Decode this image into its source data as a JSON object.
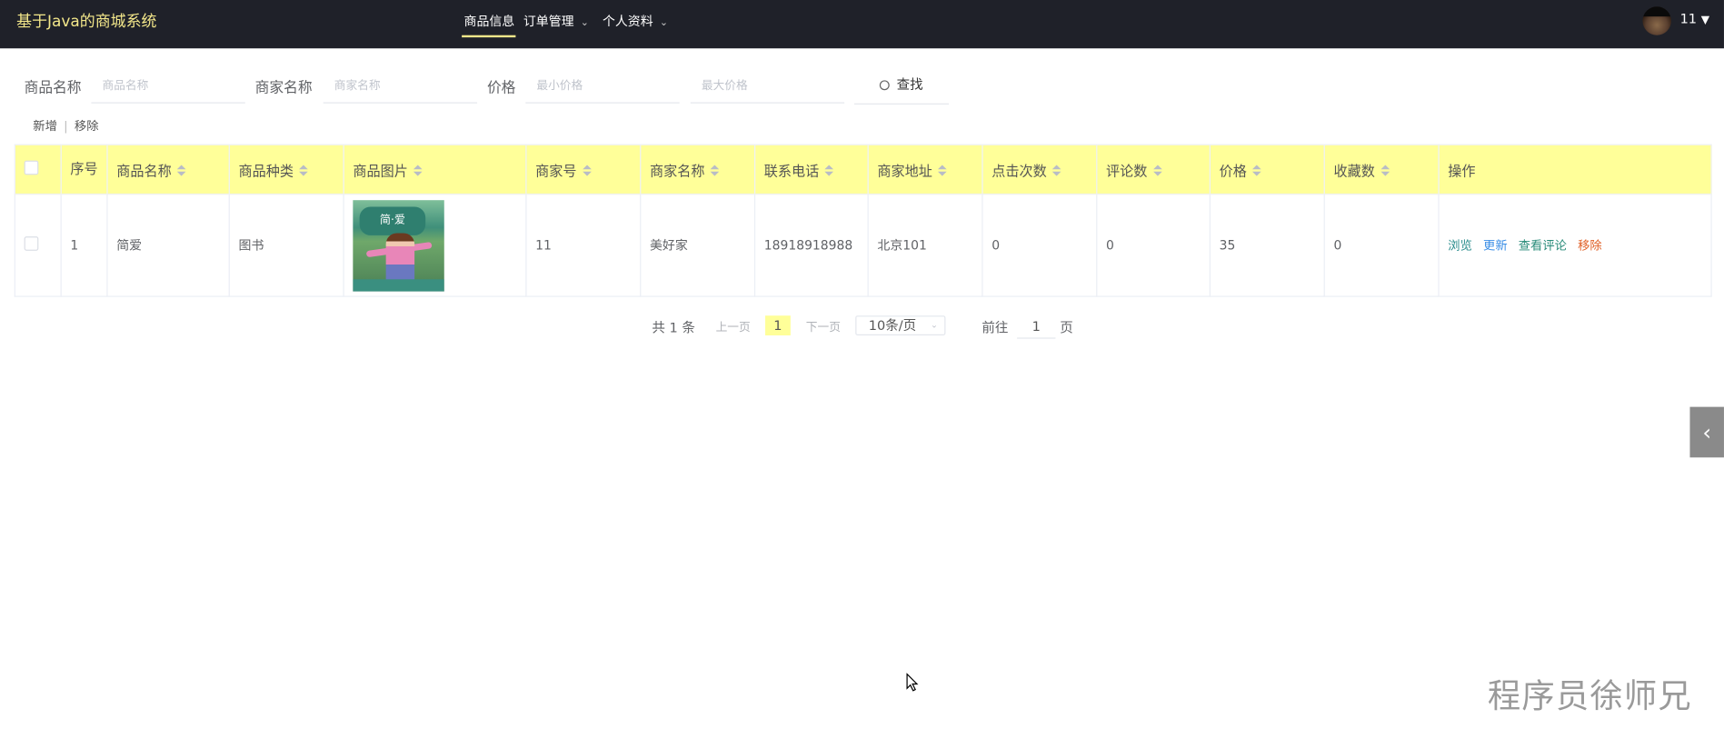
{
  "header": {
    "title": "基于Java的商城系统",
    "nav": [
      {
        "label": "商品信息",
        "active": true
      },
      {
        "label": "订单管理",
        "dropdown": true
      },
      {
        "label": "个人资料",
        "dropdown": true
      }
    ],
    "user": "11",
    "user_caret": "▼",
    "chevron": "⌄"
  },
  "search": {
    "product_name_label": "商品名称",
    "product_name_placeholder": "商品名称",
    "merchant_name_label": "商家名称",
    "merchant_name_placeholder": "商家名称",
    "price_label": "价格",
    "min_price_placeholder": "最小价格",
    "max_price_placeholder": "最大价格",
    "search_button": "查找"
  },
  "toolbar": {
    "add": "新增",
    "separator": "|",
    "remove": "移除"
  },
  "table": {
    "columns": [
      "序号",
      "商品名称",
      "商品种类",
      "商品图片",
      "商家号",
      "商家名称",
      "联系电话",
      "商家地址",
      "点击次数",
      "评论数",
      "价格",
      "收藏数",
      "操作"
    ],
    "rows": [
      {
        "index": "1",
        "name": "简爱",
        "category": "图书",
        "cover_title": "简·爱",
        "merchant_id": "11",
        "merchant_name": "美好家",
        "phone": "18918918988",
        "address": "北京101",
        "clicks": "0",
        "comments": "0",
        "price": "35",
        "favorites": "0"
      }
    ],
    "actions": {
      "view": "浏览",
      "update": "更新",
      "comments": "查看评论",
      "remove": "移除"
    }
  },
  "pagination": {
    "total": "共 1 条",
    "prev": "上一页",
    "current": "1",
    "next": "下一页",
    "page_size": "10条/页",
    "goto_label": "前往",
    "goto_value": "1",
    "page_unit": "页"
  },
  "side_tab_icon": "‹",
  "watermark": "程序员徐师兄",
  "colors": {
    "header_bg": "#1f2129",
    "accent": "#f3e78a",
    "table_header": "#ffff99",
    "view": "#2a8c8c",
    "update": "#3a8ee6",
    "comments": "#2a8c7a",
    "remove": "#e0622a"
  }
}
